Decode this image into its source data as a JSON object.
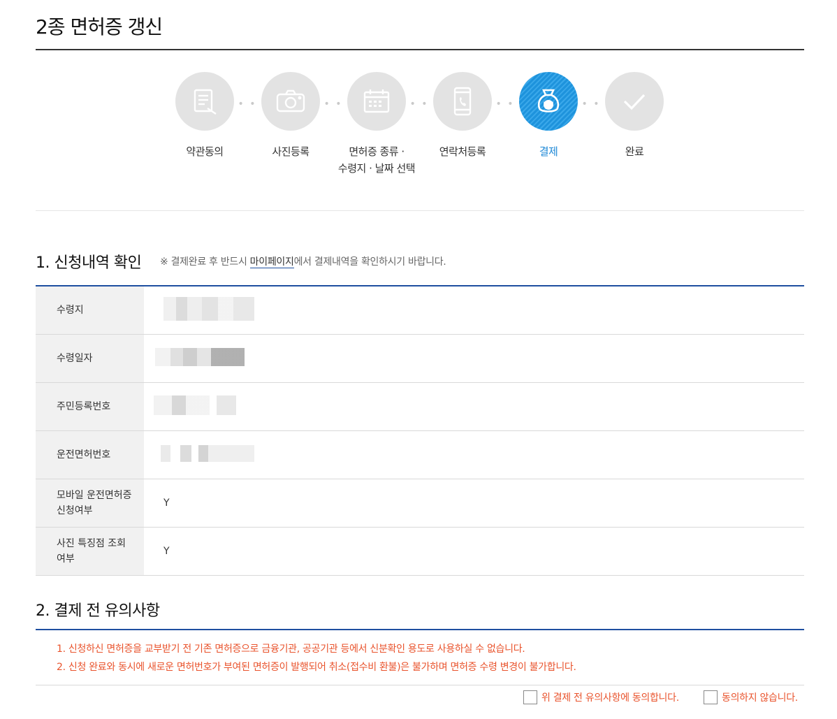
{
  "page": {
    "title": "2종 면허증 갱신"
  },
  "steps": [
    {
      "label": "약관동의",
      "icon": "document-icon",
      "active": false
    },
    {
      "label": "사진등록",
      "icon": "camera-icon",
      "active": false
    },
    {
      "label": "면허증 종류 ·",
      "label2": "수령지 · 날짜 선택",
      "icon": "calendar-icon",
      "active": false
    },
    {
      "label": "연락처등록",
      "icon": "phone-icon",
      "active": false
    },
    {
      "label": "결제",
      "icon": "money-bag-icon",
      "active": true
    },
    {
      "label": "완료",
      "icon": "check-icon",
      "active": false
    }
  ],
  "section1": {
    "title": "1. 신청내역 확인",
    "note_prefix": "※ 결제완료 후 반드시 ",
    "note_link": "마이페이지",
    "note_suffix": "에서 결제내역을 확인하시기 바랍니다.",
    "rows": [
      {
        "label": "수령지",
        "value": ""
      },
      {
        "label": "수령일자",
        "value": ""
      },
      {
        "label": "주민등록번호",
        "value": ""
      },
      {
        "label": "운전면허번호",
        "value": ""
      },
      {
        "label": "모바일 운전면허증",
        "label2": "신청여부",
        "value": "Y"
      },
      {
        "label": "사진 특징점 조회",
        "label2": "여부",
        "value": "Y"
      }
    ]
  },
  "section2": {
    "title": "2. 결제 전 유의사항",
    "notices": [
      "1. 신청하신 면허증을 교부받기 전 기존 면허증으로 금융기관, 공공기관 등에서 신분확인 용도로 사용하실 수 없습니다.",
      "2. 신청 완료와 동시에 새로운 면허번호가 부여된 면허증이 발행되어 취소(접수비 환불)은 불가하며 면허증 수령 변경이 불가합니다."
    ],
    "agree_label": "위 결제 전 유의사항에 동의합니다.",
    "disagree_label": "동의하지 않습니다."
  },
  "colors": {
    "accent": "#1e4fa0",
    "active_step": "#1e93dc",
    "warning": "#e9532c"
  }
}
